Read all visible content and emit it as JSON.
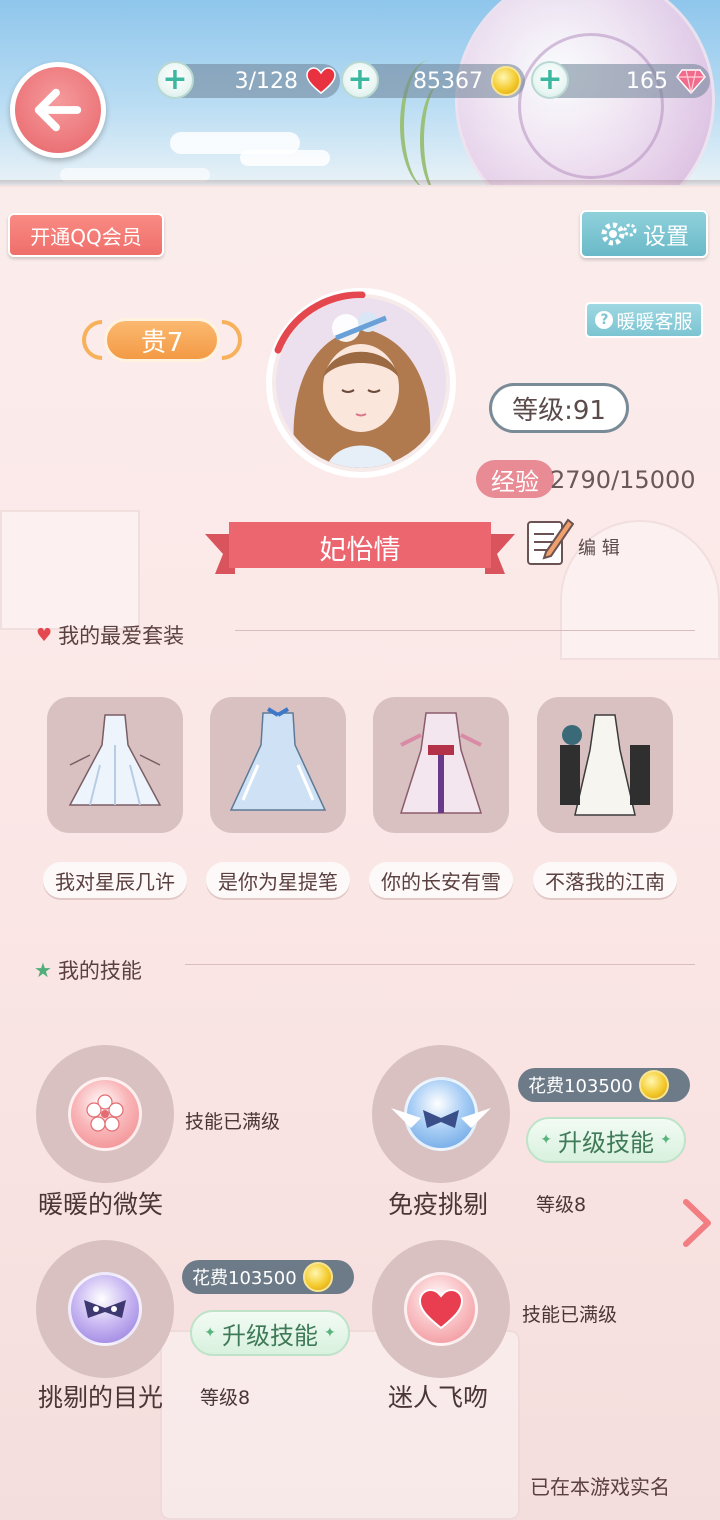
{
  "resources": {
    "hearts": "3/128",
    "gold": "85367",
    "diamonds": "165"
  },
  "buttons": {
    "qq_member": "开通QQ会员",
    "settings": "设置",
    "customer_service": "暖暖客服",
    "edit": "编 辑"
  },
  "profile": {
    "vip": "贵7",
    "level": "等级:91",
    "exp_label": "经验",
    "exp_value": "2790/15000",
    "name": "妃怡情"
  },
  "favorite_suits": {
    "title": "我的最爱套装",
    "items": [
      {
        "label": "我对星辰几许"
      },
      {
        "label": "是你为星提笔"
      },
      {
        "label": "你的长安有雪"
      },
      {
        "label": "不落我的江南"
      }
    ]
  },
  "skills": {
    "title": "我的技能",
    "items": [
      {
        "name": "暖暖的微笑",
        "note": "技能已满级"
      },
      {
        "name": "免疫挑剔",
        "cost": "花费103500",
        "upgrade": "升级技能",
        "level": "等级8"
      },
      {
        "name": "挑剔的目光",
        "cost": "花费103500",
        "upgrade": "升级技能",
        "level": "等级8"
      },
      {
        "name": "迷人飞吻",
        "note": "技能已满级"
      }
    ]
  },
  "footer": {
    "realname": "已在本游戏实名"
  },
  "colors": {
    "accent_pink": "#ec7579",
    "settings_teal": "#6ab9c8",
    "vip_orange": "#f39a45",
    "upgrade_green": "#3f7a58"
  }
}
